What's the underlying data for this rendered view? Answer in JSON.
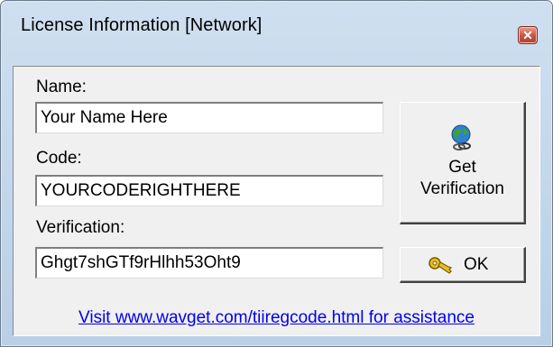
{
  "window": {
    "title": "License Information [Network]",
    "close_glyph": "✕"
  },
  "form": {
    "name_label": "Name:",
    "name_value": "Your Name Here",
    "code_label": "Code:",
    "code_value": "YOURCODERIGHTHERE",
    "verification_label": "Verification:",
    "verification_value": "Ghgt7shGTf9rHlhh53Oht9"
  },
  "buttons": {
    "get_verification_line1": "Get",
    "get_verification_line2": "Verification",
    "ok_label": "OK"
  },
  "footer": {
    "assist_link": "Visit www.wavget.com/tiiregcode.html for assistance"
  },
  "icons": {
    "get_verification": "globe-icon",
    "ok": "key-icon",
    "close": "close-icon"
  }
}
